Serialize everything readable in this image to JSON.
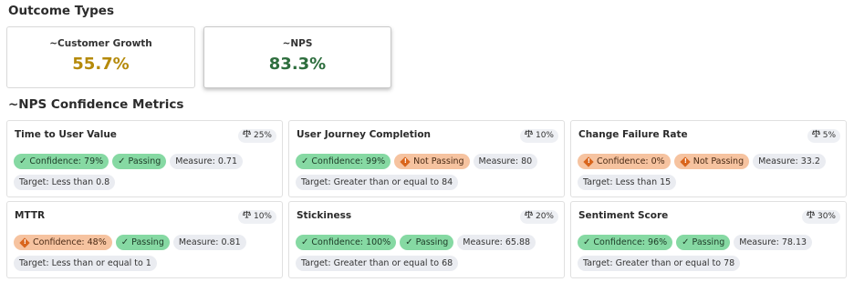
{
  "outcome_section": {
    "title": "Outcome Types",
    "cards": [
      {
        "label": "~Customer Growth",
        "value": "55.7%",
        "color": "#b58a0a",
        "selected": false
      },
      {
        "label": "~NPS",
        "value": "83.3%",
        "color": "#2e6e3e",
        "selected": true
      }
    ]
  },
  "metrics_section": {
    "title": "~NPS Confidence Metrics",
    "metrics": [
      {
        "name": "Time to User Value",
        "weight": "25%",
        "confidence": "Confidence: 79%",
        "confidence_status": "green",
        "passing": "Passing",
        "passing_status": "green",
        "measure": "Measure: 0.71",
        "target": "Target: Less than 0.8"
      },
      {
        "name": "User Journey Completion",
        "weight": "10%",
        "confidence": "Confidence: 99%",
        "confidence_status": "green",
        "passing": "Not Passing",
        "passing_status": "orange",
        "measure": "Measure: 80",
        "target": "Target: Greater than or equal to 84"
      },
      {
        "name": "Change Failure Rate",
        "weight": "5%",
        "confidence": "Confidence: 0%",
        "confidence_status": "orange",
        "passing": "Not Passing",
        "passing_status": "orange",
        "measure": "Measure: 33.2",
        "target": "Target: Less than 15"
      },
      {
        "name": "MTTR",
        "weight": "10%",
        "confidence": "Confidence: 48%",
        "confidence_status": "orange",
        "passing": "Passing",
        "passing_status": "green",
        "measure": "Measure: 0.81",
        "target": "Target: Less than or equal to 1"
      },
      {
        "name": "Stickiness",
        "weight": "20%",
        "confidence": "Confidence: 100%",
        "confidence_status": "green",
        "passing": "Passing",
        "passing_status": "green",
        "measure": "Measure: 65.88",
        "target": "Target: Greater than or equal to 68"
      },
      {
        "name": "Sentiment Score",
        "weight": "30%",
        "confidence": "Confidence: 96%",
        "confidence_status": "green",
        "passing": "Passing",
        "passing_status": "green",
        "measure": "Measure: 78.13",
        "target": "Target: Greater than or equal to 78"
      }
    ]
  }
}
